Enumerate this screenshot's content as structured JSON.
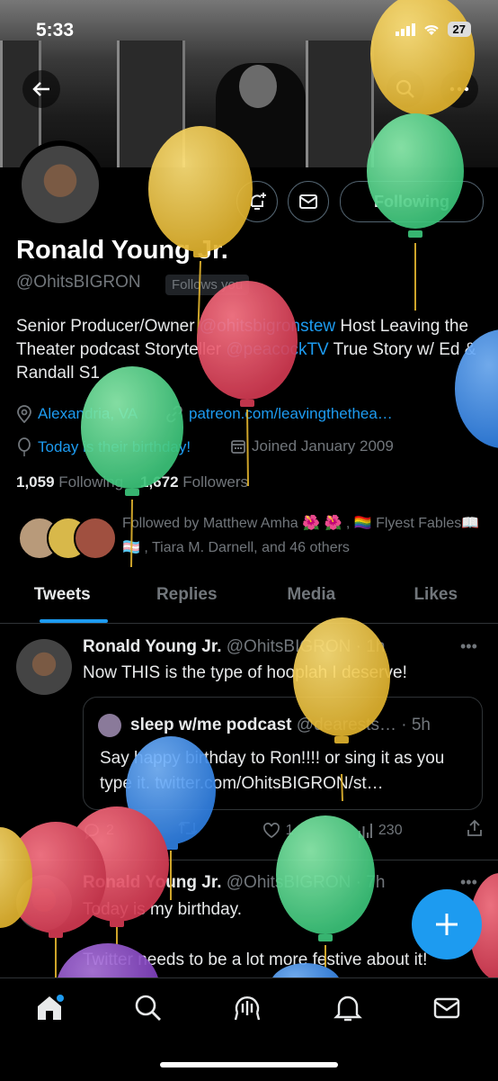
{
  "status_bar": {
    "time": "5:33",
    "battery": "27"
  },
  "profile": {
    "name": "Ronald Young Jr.",
    "handle": "@OhitsBIGRON",
    "follows_you": "Follows you",
    "following_button": "Following",
    "bio": {
      "p1": "Senior Producer/Owner ",
      "link1": "@ohitsbigronstew",
      "p2": " Host Leaving the Theater podcast Storyteller ",
      "link2": "@peacockTV",
      "p3": " True Story w/ Ed & Randall S1"
    },
    "location": "Alexandria, VA",
    "website": "patreon.com/leavingthethea…",
    "birthday": "Today is their birthday!",
    "joined": "Joined January 2009",
    "following_count": "1,059",
    "following_label": "Following",
    "followers_count": "1,672",
    "followers_label": "Followers",
    "followed_by": "Followed by Matthew Amha 🌺 🌺 , 🏳️‍🌈 Flyest Fables📖 🏳️‍⚧️ , Tiara M. Darnell, and 46 others"
  },
  "tabs": [
    {
      "label": "Tweets",
      "active": true
    },
    {
      "label": "Replies",
      "active": false
    },
    {
      "label": "Media",
      "active": false
    },
    {
      "label": "Likes",
      "active": false
    }
  ],
  "tweets": [
    {
      "name": "Ronald Young Jr.",
      "handle": "@OhitsBIGRON",
      "time": "· 1h",
      "text": "Now THIS is the type of hooplah I deserve!",
      "quote": {
        "name": "sleep w/me podcast",
        "handle": "@dearests…",
        "time": "· 5h",
        "text": "Say happy birthday to Ron!!!! or sing it as you type it. twitter.com/OhitsBIGRON/st…"
      },
      "replies": "2",
      "likes": "1",
      "views": "230"
    },
    {
      "name": "Ronald Young Jr.",
      "handle": "@OhitsBIGRON",
      "time": "· 7h",
      "text1": "Today is my birthday.",
      "text2": "Twitter needs to be a lot more festive about it!"
    }
  ],
  "icons": [
    "back-arrow-icon",
    "search-icon",
    "more-icon",
    "notification-add-icon",
    "mail-icon",
    "location-icon",
    "link-icon",
    "balloon-icon",
    "calendar-icon",
    "retweet-icon",
    "heart-icon",
    "views-icon",
    "share-icon",
    "home-icon",
    "spaces-icon",
    "bell-icon"
  ],
  "colors": {
    "accent": "#1d9bf0",
    "background": "#000000",
    "muted": "#71767b"
  }
}
